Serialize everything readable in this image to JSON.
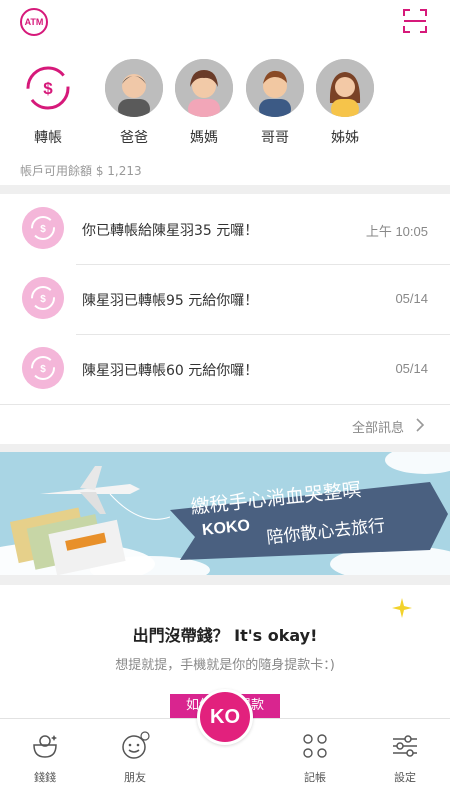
{
  "header": {
    "atm_label": "ATM",
    "scan_icon": "scan-icon"
  },
  "contacts": {
    "transfer_label": "轉帳",
    "people": [
      {
        "name": "爸爸"
      },
      {
        "name": "媽媽"
      },
      {
        "name": "哥哥"
      },
      {
        "name": "姊姊"
      }
    ],
    "balance_text": "帳戶可用餘額 $ 1,213"
  },
  "messages": {
    "items": [
      {
        "text": "你已轉帳給陳星羽35 元囉！",
        "time": "上午 10:05"
      },
      {
        "text": "陳星羽已轉帳95 元給你囉！",
        "time": "05/14"
      },
      {
        "text": "陳星羽已轉帳60 元給你囉！",
        "time": "05/14"
      }
    ],
    "all_label": "全部訊息"
  },
  "banner": {
    "line1": "繳稅手心淌血哭整暝",
    "brand": "KOKO",
    "line2": "陪你散心去旅行"
  },
  "promo": {
    "title": "出門沒帶錢？ It's okay!",
    "subtitle": "想提就提，手機就是你的隨身提款卡：)",
    "button_label": "如何無卡提款"
  },
  "tabbar": {
    "tabs": [
      {
        "label": "錢錢",
        "icon": "piggy-icon"
      },
      {
        "label": "朋友",
        "icon": "friend-icon"
      },
      {
        "label": "記帳",
        "icon": "ledger-icon"
      },
      {
        "label": "設定",
        "icon": "settings-icon"
      }
    ],
    "center_label": "KO"
  },
  "colors": {
    "accent": "#d6197a",
    "banner_bg": "#a9d5e4",
    "ribbon": "#4a6080",
    "msg_icon_bg": "#f4b6d9"
  }
}
